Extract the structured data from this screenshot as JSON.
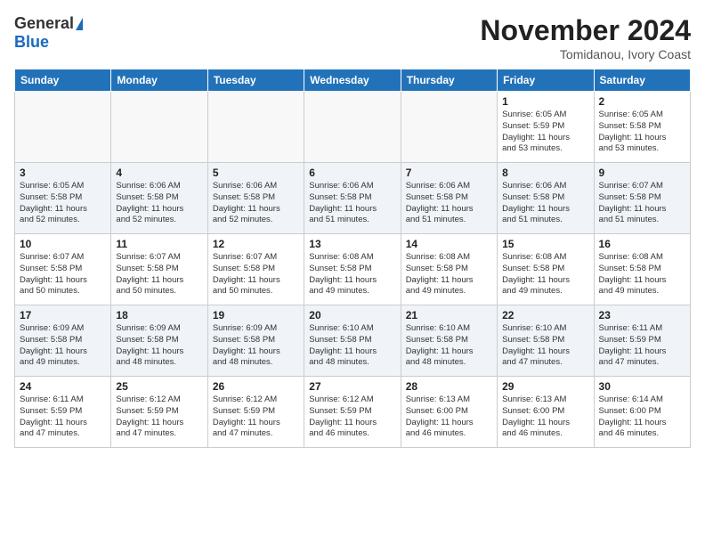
{
  "header": {
    "logo_general": "General",
    "logo_blue": "Blue",
    "month_title": "November 2024",
    "location": "Tomidanou, Ivory Coast"
  },
  "weekdays": [
    "Sunday",
    "Monday",
    "Tuesday",
    "Wednesday",
    "Thursday",
    "Friday",
    "Saturday"
  ],
  "weeks": [
    [
      {
        "day": "",
        "info": ""
      },
      {
        "day": "",
        "info": ""
      },
      {
        "day": "",
        "info": ""
      },
      {
        "day": "",
        "info": ""
      },
      {
        "day": "",
        "info": ""
      },
      {
        "day": "1",
        "info": "Sunrise: 6:05 AM\nSunset: 5:59 PM\nDaylight: 11 hours\nand 53 minutes."
      },
      {
        "day": "2",
        "info": "Sunrise: 6:05 AM\nSunset: 5:58 PM\nDaylight: 11 hours\nand 53 minutes."
      }
    ],
    [
      {
        "day": "3",
        "info": "Sunrise: 6:05 AM\nSunset: 5:58 PM\nDaylight: 11 hours\nand 52 minutes."
      },
      {
        "day": "4",
        "info": "Sunrise: 6:06 AM\nSunset: 5:58 PM\nDaylight: 11 hours\nand 52 minutes."
      },
      {
        "day": "5",
        "info": "Sunrise: 6:06 AM\nSunset: 5:58 PM\nDaylight: 11 hours\nand 52 minutes."
      },
      {
        "day": "6",
        "info": "Sunrise: 6:06 AM\nSunset: 5:58 PM\nDaylight: 11 hours\nand 51 minutes."
      },
      {
        "day": "7",
        "info": "Sunrise: 6:06 AM\nSunset: 5:58 PM\nDaylight: 11 hours\nand 51 minutes."
      },
      {
        "day": "8",
        "info": "Sunrise: 6:06 AM\nSunset: 5:58 PM\nDaylight: 11 hours\nand 51 minutes."
      },
      {
        "day": "9",
        "info": "Sunrise: 6:07 AM\nSunset: 5:58 PM\nDaylight: 11 hours\nand 51 minutes."
      }
    ],
    [
      {
        "day": "10",
        "info": "Sunrise: 6:07 AM\nSunset: 5:58 PM\nDaylight: 11 hours\nand 50 minutes."
      },
      {
        "day": "11",
        "info": "Sunrise: 6:07 AM\nSunset: 5:58 PM\nDaylight: 11 hours\nand 50 minutes."
      },
      {
        "day": "12",
        "info": "Sunrise: 6:07 AM\nSunset: 5:58 PM\nDaylight: 11 hours\nand 50 minutes."
      },
      {
        "day": "13",
        "info": "Sunrise: 6:08 AM\nSunset: 5:58 PM\nDaylight: 11 hours\nand 49 minutes."
      },
      {
        "day": "14",
        "info": "Sunrise: 6:08 AM\nSunset: 5:58 PM\nDaylight: 11 hours\nand 49 minutes."
      },
      {
        "day": "15",
        "info": "Sunrise: 6:08 AM\nSunset: 5:58 PM\nDaylight: 11 hours\nand 49 minutes."
      },
      {
        "day": "16",
        "info": "Sunrise: 6:08 AM\nSunset: 5:58 PM\nDaylight: 11 hours\nand 49 minutes."
      }
    ],
    [
      {
        "day": "17",
        "info": "Sunrise: 6:09 AM\nSunset: 5:58 PM\nDaylight: 11 hours\nand 49 minutes."
      },
      {
        "day": "18",
        "info": "Sunrise: 6:09 AM\nSunset: 5:58 PM\nDaylight: 11 hours\nand 48 minutes."
      },
      {
        "day": "19",
        "info": "Sunrise: 6:09 AM\nSunset: 5:58 PM\nDaylight: 11 hours\nand 48 minutes."
      },
      {
        "day": "20",
        "info": "Sunrise: 6:10 AM\nSunset: 5:58 PM\nDaylight: 11 hours\nand 48 minutes."
      },
      {
        "day": "21",
        "info": "Sunrise: 6:10 AM\nSunset: 5:58 PM\nDaylight: 11 hours\nand 48 minutes."
      },
      {
        "day": "22",
        "info": "Sunrise: 6:10 AM\nSunset: 5:58 PM\nDaylight: 11 hours\nand 47 minutes."
      },
      {
        "day": "23",
        "info": "Sunrise: 6:11 AM\nSunset: 5:59 PM\nDaylight: 11 hours\nand 47 minutes."
      }
    ],
    [
      {
        "day": "24",
        "info": "Sunrise: 6:11 AM\nSunset: 5:59 PM\nDaylight: 11 hours\nand 47 minutes."
      },
      {
        "day": "25",
        "info": "Sunrise: 6:12 AM\nSunset: 5:59 PM\nDaylight: 11 hours\nand 47 minutes."
      },
      {
        "day": "26",
        "info": "Sunrise: 6:12 AM\nSunset: 5:59 PM\nDaylight: 11 hours\nand 47 minutes."
      },
      {
        "day": "27",
        "info": "Sunrise: 6:12 AM\nSunset: 5:59 PM\nDaylight: 11 hours\nand 46 minutes."
      },
      {
        "day": "28",
        "info": "Sunrise: 6:13 AM\nSunset: 6:00 PM\nDaylight: 11 hours\nand 46 minutes."
      },
      {
        "day": "29",
        "info": "Sunrise: 6:13 AM\nSunset: 6:00 PM\nDaylight: 11 hours\nand 46 minutes."
      },
      {
        "day": "30",
        "info": "Sunrise: 6:14 AM\nSunset: 6:00 PM\nDaylight: 11 hours\nand 46 minutes."
      }
    ]
  ]
}
